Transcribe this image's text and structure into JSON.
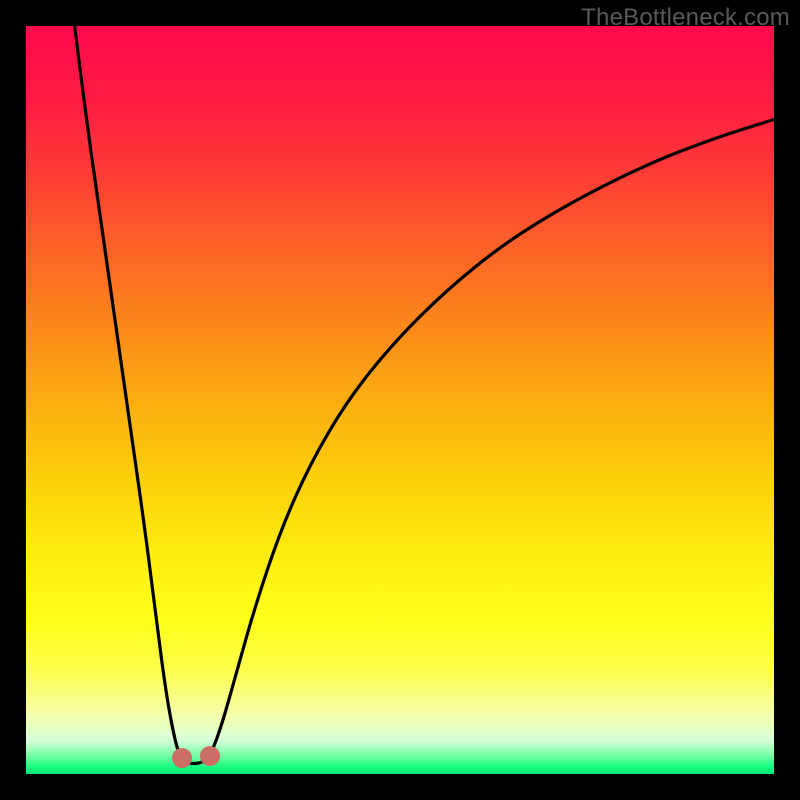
{
  "watermark": "TheBottleneck.com",
  "chart_data": {
    "type": "line",
    "title": "",
    "xlabel": "",
    "ylabel": "",
    "xlim": [
      0,
      100
    ],
    "ylim": [
      0,
      100
    ],
    "gradient_stops": [
      {
        "offset": 0.0,
        "color": "#ff0a4d"
      },
      {
        "offset": 0.1,
        "color": "#ff1b43"
      },
      {
        "offset": 0.2,
        "color": "#fe3d35"
      },
      {
        "offset": 0.3,
        "color": "#fc6327"
      },
      {
        "offset": 0.4,
        "color": "#fb881a"
      },
      {
        "offset": 0.5,
        "color": "#fbac10"
      },
      {
        "offset": 0.6,
        "color": "#fcce0b"
      },
      {
        "offset": 0.7,
        "color": "#fdeb0e"
      },
      {
        "offset": 0.8,
        "color": "#feff1e"
      },
      {
        "offset": 0.86,
        "color": "#feff4a"
      },
      {
        "offset": 0.92,
        "color": "#f5ffa9"
      },
      {
        "offset": 0.955,
        "color": "#d7ffd9"
      },
      {
        "offset": 0.975,
        "color": "#77ffa4"
      },
      {
        "offset": 0.99,
        "color": "#1cff83"
      },
      {
        "offset": 1.0,
        "color": "#00e873"
      }
    ],
    "series": [
      {
        "name": "left-branch",
        "x": [
          6.5,
          8.0,
          10.0,
          12.0,
          14.0,
          16.0,
          17.5,
          18.7,
          19.7,
          20.4,
          20.9
        ],
        "y": [
          100.0,
          88.0,
          74.0,
          60.0,
          46.0,
          32.0,
          20.0,
          11.0,
          5.5,
          2.8,
          2.2
        ]
      },
      {
        "name": "bottom-arc",
        "x": [
          20.9,
          21.4,
          22.0,
          22.8,
          23.6,
          24.2,
          24.6
        ],
        "y": [
          2.2,
          1.6,
          1.4,
          1.4,
          1.6,
          2.0,
          2.4
        ]
      },
      {
        "name": "right-branch",
        "x": [
          24.6,
          26.0,
          28.0,
          30.5,
          34.0,
          38.0,
          43.0,
          49.0,
          56.0,
          64.0,
          73.0,
          83.0,
          92.0,
          100.0
        ],
        "y": [
          2.4,
          6.0,
          13.0,
          22.0,
          32.5,
          41.5,
          50.0,
          57.5,
          64.5,
          71.0,
          76.5,
          81.5,
          85.0,
          87.5
        ]
      }
    ],
    "markers": [
      {
        "name": "left-dot",
        "x": 20.9,
        "y": 2.2,
        "color": "#cb6e66"
      },
      {
        "name": "right-dot",
        "x": 24.6,
        "y": 2.4,
        "color": "#cb6e66"
      }
    ]
  }
}
